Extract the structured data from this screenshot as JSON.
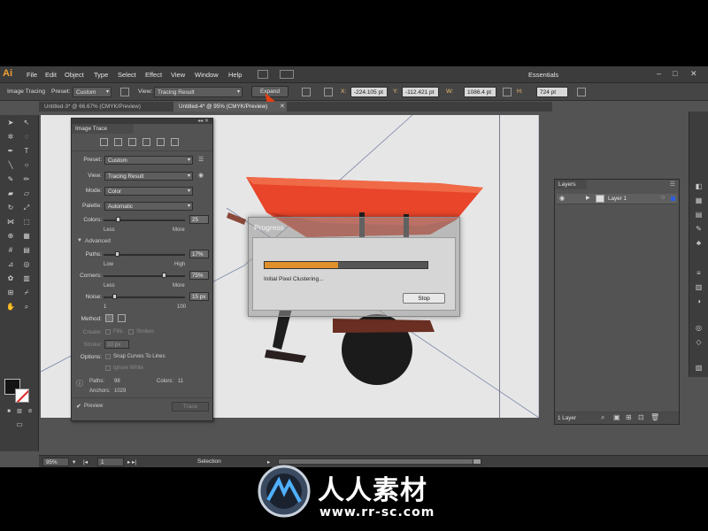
{
  "app": {
    "logo_text": "Ai",
    "menu": [
      "File",
      "Edit",
      "Object",
      "Type",
      "Select",
      "Effect",
      "View",
      "Window",
      "Help"
    ],
    "workspace": "Essentials",
    "window_controls": [
      "–",
      "□",
      "✕"
    ]
  },
  "controlbar": {
    "image_tracing_label": "Image Tracing",
    "preset_label": "Preset:",
    "preset_value": "Custom",
    "view_label": "View:",
    "view_value": "Tracing Result",
    "expand_label": "Expand",
    "x_label": "X:",
    "x_value": "-224.105 pt",
    "y_label": "Y:",
    "y_value": "-112.421 pt",
    "w_label": "W:",
    "w_value": "1086.4 pt",
    "h_label": "H:",
    "h_value": "724 pt"
  },
  "tabs": [
    {
      "label": "Untitled-3* @ 66.67% (CMYK/Preview)",
      "active": false
    },
    {
      "label": "Untitled-4* @ 95% (CMYK/Preview)",
      "active": true
    }
  ],
  "image_trace": {
    "title": "Image Trace",
    "preset_label": "Preset:",
    "preset_value": "Custom",
    "view_label": "View:",
    "view_value": "Tracing Result",
    "mode_label": "Mode:",
    "mode_value": "Color",
    "palette_label": "Palette:",
    "palette_value": "Automatic",
    "colors_label": "Colors:",
    "colors_value": "25",
    "colors_fraction": 0.18,
    "colors_less": "Less",
    "colors_more": "More",
    "advanced_label": "Advanced",
    "paths_label": "Paths:",
    "paths_value": "17%",
    "paths_fraction": 0.17,
    "paths_low": "Low",
    "paths_high": "High",
    "corners_label": "Corners:",
    "corners_value": "75%",
    "corners_fraction": 0.75,
    "corners_less": "Less",
    "corners_more": "More",
    "noise_label": "Noise:",
    "noise_value": "15 px",
    "noise_fraction": 0.14,
    "noise_min": "1",
    "noise_max": "100",
    "method_label": "Method:",
    "create_label": "Create:",
    "fills_label": "Fills",
    "strokes_label": "Strokes",
    "stroke_label": "Stroke:",
    "stroke_value": "10 px",
    "options_label": "Options:",
    "snap_label": "Snap Curves To Lines",
    "ignore_white_label": "Ignore White",
    "paths_count_label": "Paths:",
    "paths_count": "98",
    "colors_count_label": "Colors:",
    "colors_count": "11",
    "anchors_label": "Anchors:",
    "anchors_count": "1029",
    "preview_label": "Preview",
    "trace_button": "Trace"
  },
  "layers": {
    "title": "Layers",
    "layer_name": "Layer 1",
    "footer_count": "1 Layer"
  },
  "progress": {
    "title": "Progress",
    "fraction": 0.45,
    "message": "Initial Pixel Clustering...",
    "stop_label": "Stop"
  },
  "statusbar": {
    "zoom": "95%",
    "page": "1",
    "mode": "Selection"
  },
  "watermark": {
    "cn_text": "人人素材",
    "url_text": "www.rr-sc.com"
  },
  "colors": {
    "accent_orange": "#e0902a",
    "wheelbarrow_red": "#e8452a",
    "artboard": "#e6e6e6"
  }
}
